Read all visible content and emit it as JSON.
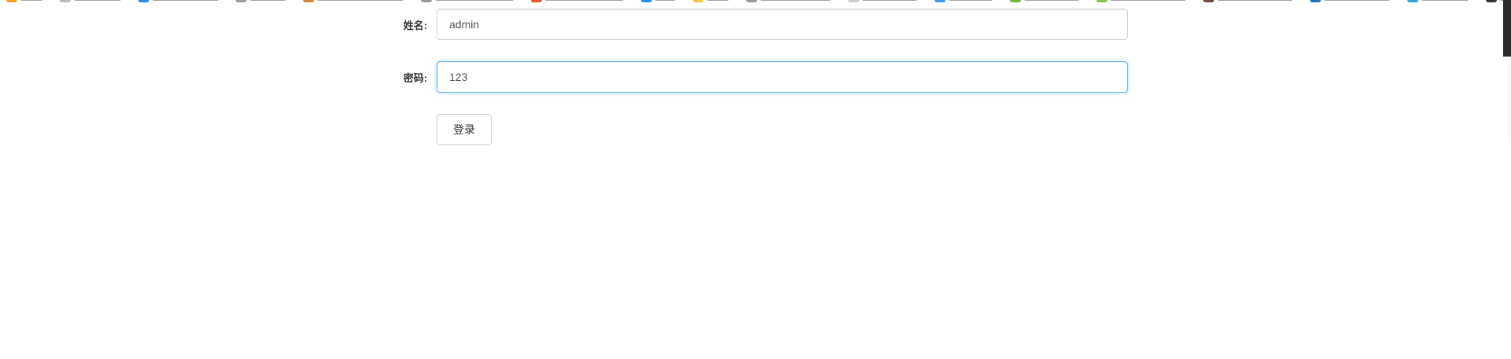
{
  "form": {
    "username_label": "姓名:",
    "username_value": "admin",
    "password_label": "密码:",
    "password_value": "123",
    "submit_label": "登录"
  },
  "colors": {
    "focus_border": "#66afe9",
    "input_border": "#cccccc",
    "label_text": "#333333"
  },
  "bookmarks_bar": {
    "icons": [
      "star-icon",
      "doc-icon",
      "link-icon",
      "globe-icon",
      "image-icon",
      "globe-icon",
      "fire-icon",
      "doc-icon",
      "lightning-icon",
      "globe-icon",
      "arrow-icon",
      "feather-icon",
      "leaf-icon",
      "circle-icon",
      "tree-icon",
      "book-icon",
      "play-icon",
      "doc-icon",
      "folder-icon"
    ]
  }
}
